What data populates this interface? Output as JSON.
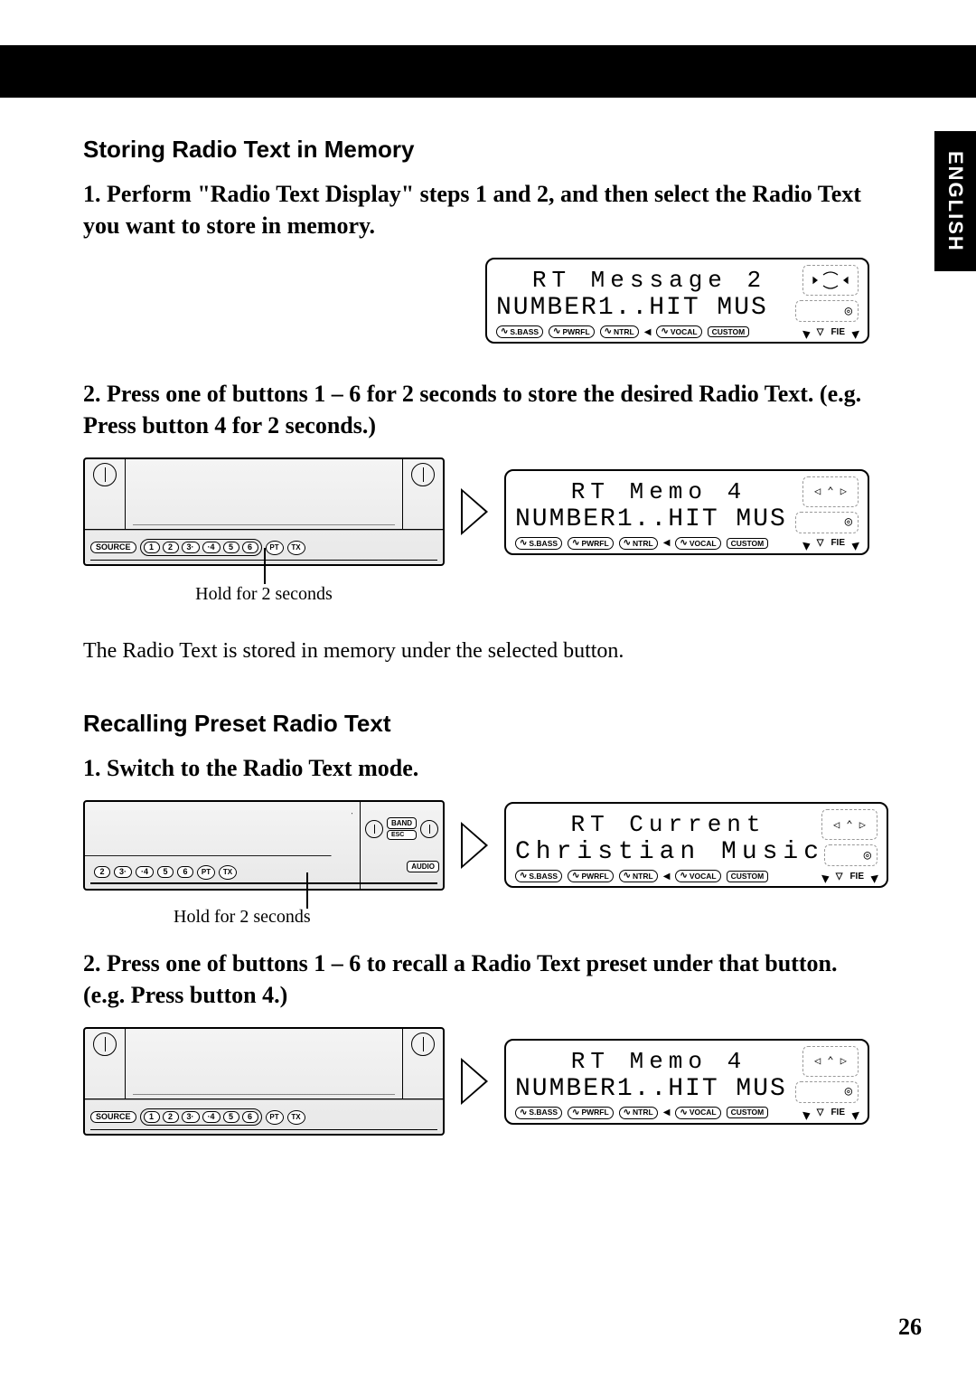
{
  "language_tab": "ENGLISH",
  "page_number": "26",
  "section_a": {
    "heading": "Storing Radio Text in Memory",
    "step1": "1. Perform \"Radio Text Display\" steps 1 and 2, and then select the Radio Text you want to store in memory.",
    "step2": "2. Press one of buttons 1 – 6 for 2 seconds to store the desired Radio Text. (e.g. Press button 4 for 2 seconds.)",
    "hold_caption": "Hold for 2 seconds",
    "result_text": "The Radio Text is stored in memory under the selected button."
  },
  "section_b": {
    "heading": "Recalling Preset Radio Text",
    "step1": "1. Switch to the Radio Text mode.",
    "hold_caption": "Hold for 2 seconds",
    "step2": "2. Press one of buttons 1 – 6 to recall a Radio Text preset under that button. (e.g. Press button 4.)"
  },
  "lcd1": {
    "line1": "RT Message 2",
    "line2": "NUMBER1..HIT MUS"
  },
  "lcd2": {
    "line1": "RT Memo 4",
    "line2": "NUMBER1..HIT MUS"
  },
  "lcd3": {
    "line1": "RT Current",
    "line2": "Christian Music"
  },
  "lcd4": {
    "line1": "RT Memo 4",
    "line2": "NUMBER1..HIT MUS"
  },
  "lcd_icons": {
    "sbass": "S.BASS",
    "pwrfl": "PWRFL",
    "ntrl": "NTRL",
    "vocal": "VOCAL",
    "custom": "CUSTOM",
    "fie": "FIE"
  },
  "device": {
    "source": "SOURCE",
    "buttons": [
      "1",
      "2",
      "3·",
      "·4",
      "5",
      "6"
    ],
    "pt": "PT",
    "tx": "TX",
    "band": "BAND",
    "esc": "ESC",
    "audio": "AUDIO"
  }
}
